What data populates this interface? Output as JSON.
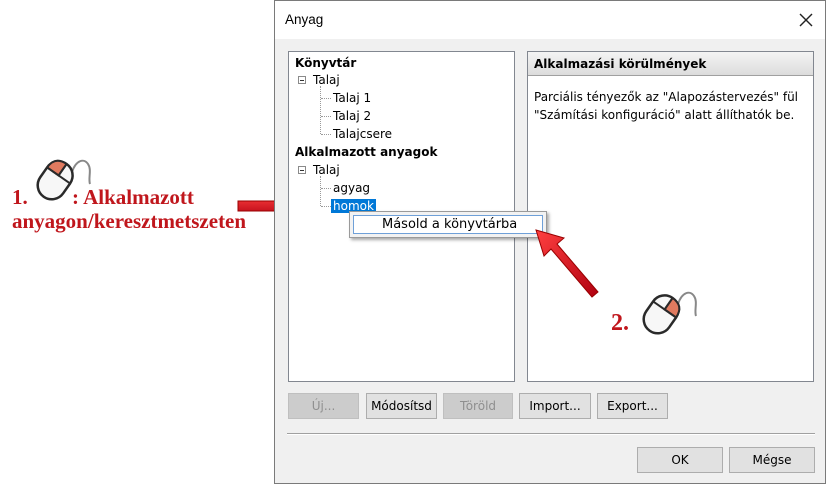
{
  "annotations": {
    "step1_number": "1.",
    "step1_line1": ": Alkalmazott",
    "step1_line2": "anyagon/keresztmetszeten",
    "step2_number": "2.",
    "color": "#c0161c"
  },
  "dialog": {
    "title": "Anyag",
    "close_icon": "close-icon"
  },
  "tree": {
    "library_label": "Könyvtár",
    "library_group": "Talaj",
    "library_items": [
      "Talaj 1",
      "Talaj 2",
      "Talajcsere"
    ],
    "applied_label": "Alkalmazott anyagok",
    "applied_group": "Talaj",
    "applied_items": [
      "agyag",
      "homok"
    ],
    "selected_item": "homok"
  },
  "context_menu": {
    "item": "Másold a könyvtárba"
  },
  "info_panel": {
    "header": "Alkalmazási körülmények",
    "text": "Parciális tényezők az \"Alapozástervezés\" fül \"Számítási konfiguráció\" alatt állíthatók be."
  },
  "buttons": {
    "new": "Új...",
    "modify": "Módosítsd",
    "delete": "Töröld",
    "import": "Import...",
    "export": "Export...",
    "ok": "OK",
    "cancel": "Mégse"
  }
}
